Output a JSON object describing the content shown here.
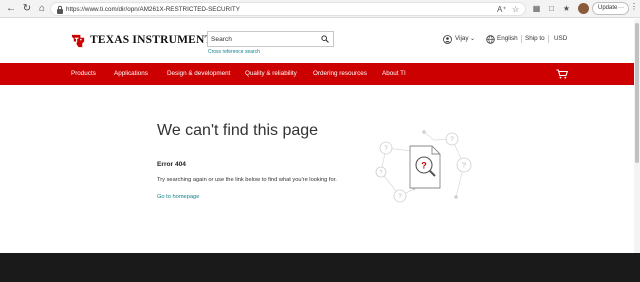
{
  "browser": {
    "url": "https://www.ti.com/dir/opn/AM261X-RESTRICTED-SECURITY",
    "update_label": "Update",
    "icons": [
      "back-icon",
      "refresh-icon",
      "home-icon",
      "lock-icon",
      "read-aloud-icon",
      "favorite-star-icon",
      "extensions-icon",
      "sidebar-icon",
      "copilot-icon",
      "favorites-icon",
      "profile-avatar",
      "more-icon"
    ]
  },
  "header": {
    "brand": "Texas Instruments",
    "search_placeholder": "Search",
    "cross_reference": "Cross reference search",
    "user": "Vijay",
    "language": "English",
    "ship_to": "Ship to",
    "currency": "USD"
  },
  "nav": {
    "items": [
      "Products",
      "Applications",
      "Design & development",
      "Quality & reliability",
      "Ordering resources",
      "About TI"
    ]
  },
  "error": {
    "title": "We can't find this page",
    "code": "Error 404",
    "message": "Try searching again or use the link below to find what you're looking for.",
    "link": "Go to homepage"
  },
  "illustration": {
    "mark": "?"
  },
  "colors": {
    "brand_red": "#cc0000",
    "link_teal": "#118189",
    "footer": "#1a1a1a"
  }
}
